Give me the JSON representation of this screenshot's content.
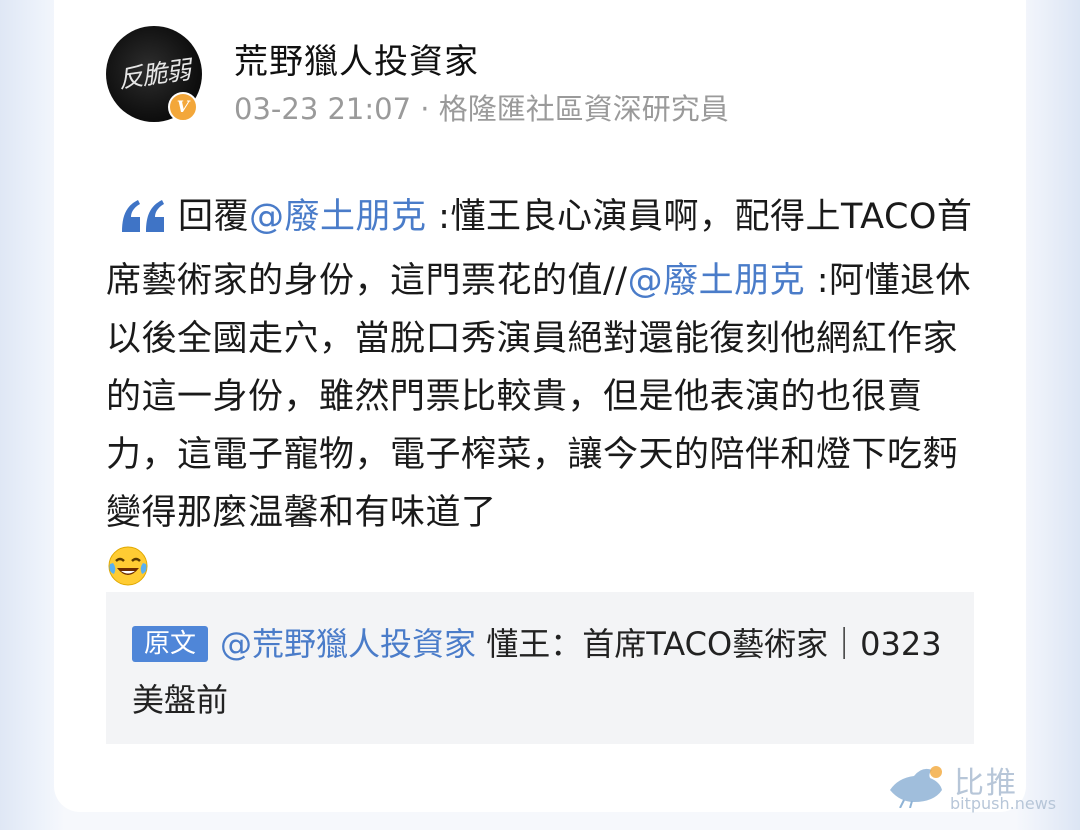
{
  "post": {
    "avatar_text": "反脆弱",
    "verified_badge": "V",
    "username": "荒野獵人投資家",
    "meta": "03-23 21:07 · 格隆匯社區資深研究員",
    "content": {
      "quote_icon": "quote-icon",
      "reply_prefix": "回覆",
      "mention_1": "@廢土朋克",
      "text_1": " :懂王良心演員啊，配得上TACO首席藝術家的身份，這門票花的值//",
      "mention_2": "@廢土朋克",
      "text_2": " :阿懂退休以後全國走穴，當脫口秀演員絕對還能復刻他網紅作家的這一身份，雖然門票比較貴，但是他表演的也很賣力，這電子寵物，電子榨菜，讓今天的陪伴和燈下吃麪變得那麼温馨和有味道了",
      "emoji": "laughing-tears-emoji"
    },
    "original": {
      "tag": "原文",
      "mention": "@荒野獵人投資家",
      "text": " 懂王：首席TACO藝術家｜0323美盤前"
    }
  },
  "watermark": {
    "brand_cn": "比推",
    "brand_en": "bitpush.news",
    "icon": "bird-logo-icon"
  },
  "colors": {
    "mention": "#4a7cc9",
    "tag_bg": "#4f86d8",
    "badge": "#f3a73a",
    "meta_text": "#9a9a9a"
  }
}
